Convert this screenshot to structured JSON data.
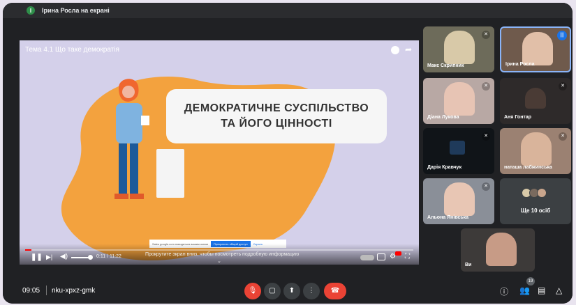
{
  "presenting_banner": {
    "initial": "I",
    "label": "Ірина Росла на екрані"
  },
  "video": {
    "title": "Тема 4.1 Що таке демократія",
    "headline_line1": "ДЕМОКРАТИЧНЕ СУСПІЛЬСТВО",
    "headline_line2": "ТА ЙОГО ЦІННОСТІ",
    "cookie_text": "Sales google.com поводиться вашим окном",
    "cookie_accept": "Прекратить общий доступ",
    "cookie_close": "Скрыть",
    "time": "0:11 / 11:22",
    "progress": 0.016,
    "volume": 0.8,
    "scroll_hint": "Прокрутите экран вниз, чтобы посмотреть подробную информацию",
    "chevron": "⌄"
  },
  "participants": [
    {
      "name": "Макс Скрипник",
      "muted": true
    },
    {
      "name": "Ірина Росла",
      "active": true
    },
    {
      "name": "Діана Лукова",
      "muted": true
    },
    {
      "name": "Аня Гонтар",
      "muted": true
    },
    {
      "name": "Дарія Кравчук",
      "muted": true
    },
    {
      "name": "наташа лабжинська",
      "muted": true
    },
    {
      "name": "Альона Янівська",
      "muted": true
    },
    {
      "name": "Ще 10 осіб"
    },
    {
      "name": "Ви"
    }
  ],
  "bottom_bar": {
    "time": "09:05",
    "meeting_code": "nku-xpxz-gmk",
    "people_count": "19"
  },
  "icons": {
    "mic": "🎙",
    "camera": "▢",
    "present": "⬆",
    "more": "⋮",
    "leave": "☎",
    "info": "ⓘ",
    "people": "👥",
    "chat": "▤",
    "activities": "△"
  },
  "colors": {
    "accent": "#1a73e8",
    "danger": "#ea4335",
    "slide_orange": "#f3a23e"
  }
}
